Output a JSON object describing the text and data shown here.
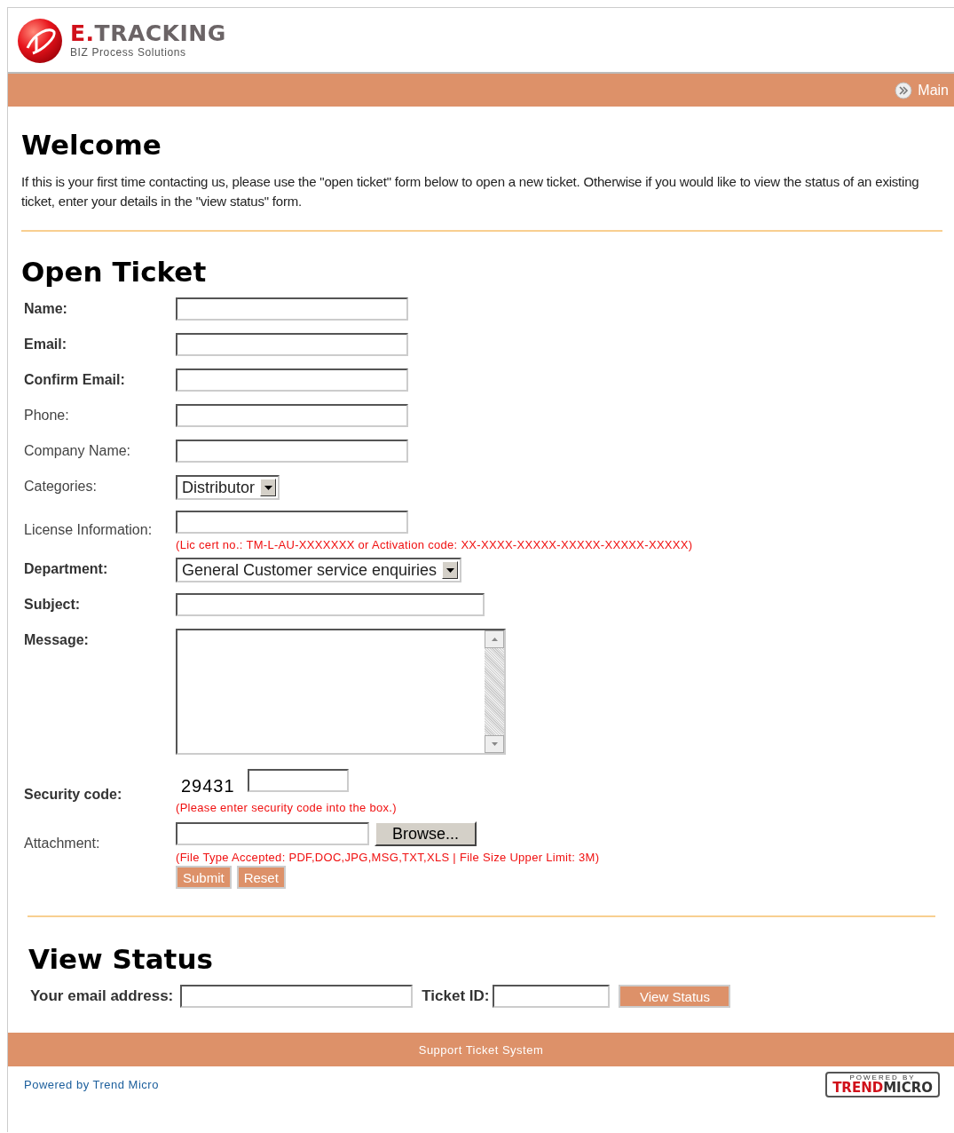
{
  "header": {
    "logo_mark": "E.",
    "logo_word": "TRACKING",
    "tagline": "BIZ Process Solutions"
  },
  "nav": {
    "link": "Main"
  },
  "welcome": {
    "title": "Welcome",
    "text": "If this is your first time contacting us, please use the \"open ticket\" form below to open a new ticket. Otherwise if you would like to view the status of an existing ticket, enter your details in the \"view status\" form."
  },
  "open_ticket": {
    "title": "Open Ticket",
    "fields": [
      {
        "label": "Name:",
        "bold": true,
        "kind": "text"
      },
      {
        "label": "Email:",
        "bold": true,
        "kind": "text"
      },
      {
        "label": "Confirm Email:",
        "bold": true,
        "kind": "text"
      },
      {
        "label": "Phone:",
        "bold": false,
        "kind": "text"
      },
      {
        "label": "Company Name:",
        "bold": false,
        "kind": "text"
      },
      {
        "label": "Categories:",
        "bold": false,
        "kind": "select",
        "value": "Distributor"
      },
      {
        "label": "License Information:",
        "bold": false,
        "kind": "text",
        "hint": "(Lic cert no.: TM-L-AU-XXXXXXX or Activation code: XX-XXXX-XXXXX-XXXXX-XXXXX-XXXXX)"
      },
      {
        "label": "Department:",
        "bold": true,
        "kind": "select",
        "value": "General Customer service enquiries"
      },
      {
        "label": "Subject:",
        "bold": true,
        "kind": "wide"
      },
      {
        "label": "Message:",
        "bold": true,
        "kind": "textarea"
      },
      {
        "label": "Security code:",
        "bold": true,
        "kind": "captcha",
        "code": "29431",
        "hint": "(Please enter security code into the box.)"
      },
      {
        "label": "Attachment:",
        "bold": false,
        "kind": "file",
        "button": "Browse...",
        "hint": "(File Type Accepted: PDF,DOC,JPG,MSG,TXT,XLS | File Size Upper Limit: 3M)"
      }
    ],
    "buttons": [
      "Submit",
      "Reset"
    ]
  },
  "view_status": {
    "title": "View Status",
    "email_label": "Your email address:",
    "ticket_label": "Ticket ID:",
    "button": "View Status"
  },
  "footer": {
    "bar_text": "Support Ticket System",
    "link": "Powered by Trend Micro",
    "badge_top": "POWERED BY",
    "badge_red": "TREND",
    "badge_dark": "MICRO"
  }
}
